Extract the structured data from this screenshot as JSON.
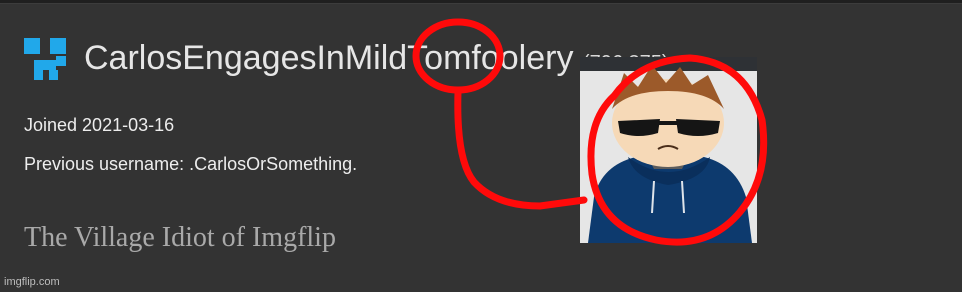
{
  "profile": {
    "username": "CarlosEngagesInMildTomfoolery",
    "points": "(796,375)",
    "joined": "Joined 2021-03-16",
    "previous_username": "Previous username: .CarlosOrSomething.",
    "bio": "The Village Idiot of Imgflip"
  },
  "watermark": "imgflip.com",
  "icons": {
    "logo": "imgflip-logo-icon",
    "avatar": "cartoon-avatar"
  },
  "colors": {
    "background": "#333333",
    "logo": "#21a8ea",
    "annotation": "#ff0a0a",
    "hoodie": "#0d3a6e"
  }
}
